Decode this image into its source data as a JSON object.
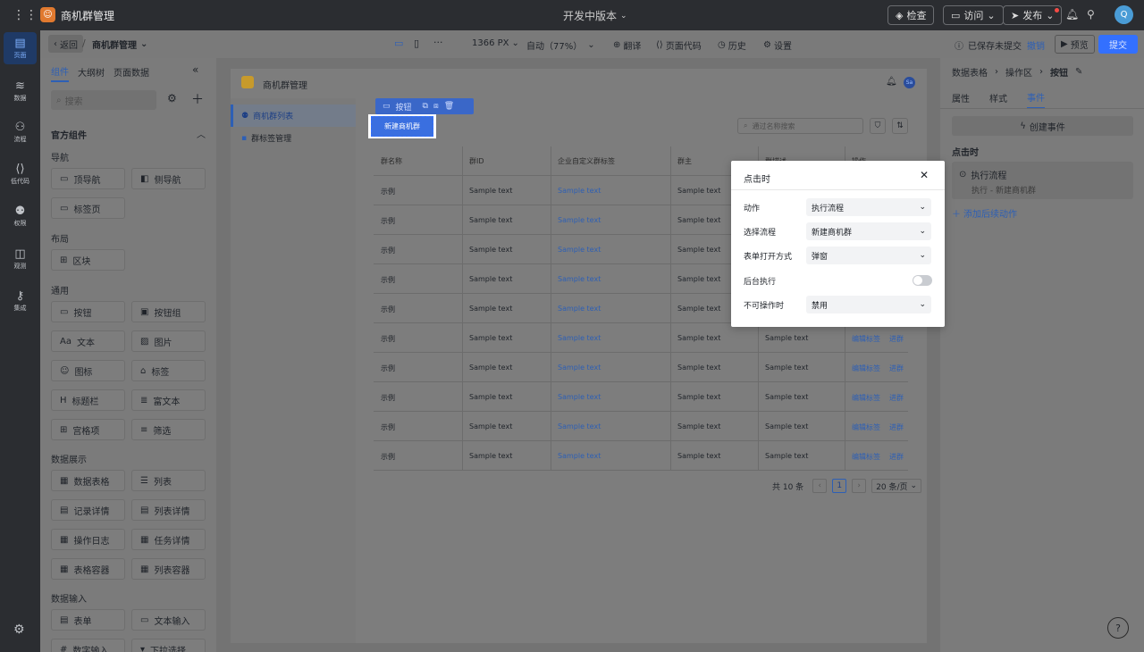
{
  "app": {
    "title": "商机群管理",
    "version_label": "开发中版本",
    "avatar_text": "Q"
  },
  "top_actions": {
    "inspect": "检查",
    "visit": "访问",
    "publish": "发布"
  },
  "rail": [
    "页面",
    "数据",
    "流程",
    "低代码",
    "权限",
    "观测",
    "集成"
  ],
  "toolbar": {
    "back": "返回",
    "separator": "/",
    "page_name": "商机群管理",
    "width": "1366 PX",
    "zoom": "自动（77%）",
    "translate": "翻译",
    "page_code": "页面代码",
    "history": "历史",
    "settings": "设置",
    "saved": "已保存未提交",
    "undo": "撤销",
    "preview": "预览",
    "submit": "提交"
  },
  "left_panel": {
    "tabs": [
      "组件",
      "大纲树",
      "页面数据"
    ],
    "search_placeholder": "搜索",
    "section_title": "官方组件",
    "groups": {
      "nav": {
        "title": "导航",
        "items": [
          "顶导航",
          "侧导航",
          "标签页"
        ]
      },
      "layout": {
        "title": "布局",
        "items": [
          "区块"
        ]
      },
      "general": {
        "title": "通用",
        "items": [
          "按钮",
          "按钮组",
          "文本",
          "图片",
          "图标",
          "标签",
          "标题栏",
          "富文本",
          "宫格项",
          "筛选"
        ]
      },
      "display": {
        "title": "数据展示",
        "items": [
          "数据表格",
          "列表",
          "记录详情",
          "列表详情",
          "操作日志",
          "任务详情",
          "表格容器",
          "列表容器"
        ]
      },
      "input": {
        "title": "数据输入",
        "items": [
          "表单",
          "文本输入",
          "数字输入",
          "下拉选择"
        ]
      }
    }
  },
  "canvas": {
    "header_title": "商机群管理",
    "header_avatar": "Sa",
    "side_nav": [
      "商机群列表",
      "群标签管理"
    ],
    "button_toolbar_label": "按钮",
    "create_button": "新建商机群",
    "search_placeholder": "通过名称搜索",
    "columns": [
      "群名称",
      "群ID",
      "企业自定义群标签",
      "群主",
      "群描述",
      "操作"
    ],
    "rows": [
      [
        "示例",
        "Sample text",
        "Sample text",
        "Sample text",
        "Sample text",
        "编辑标签",
        "进群"
      ],
      [
        "示例",
        "Sample text",
        "Sample text",
        "Sample text",
        "Sample text",
        "编辑标签",
        "进群"
      ],
      [
        "示例",
        "Sample text",
        "Sample text",
        "Sample text",
        "Sample text",
        "编辑标签",
        "进群"
      ],
      [
        "示例",
        "Sample text",
        "Sample text",
        "Sample text",
        "Sample text",
        "编辑标签",
        "进群"
      ],
      [
        "示例",
        "Sample text",
        "Sample text",
        "Sample text",
        "Sample text",
        "编辑标签",
        "进群"
      ],
      [
        "示例",
        "Sample text",
        "Sample text",
        "Sample text",
        "Sample text",
        "编辑标签",
        "进群"
      ],
      [
        "示例",
        "Sample text",
        "Sample text",
        "Sample text",
        "Sample text",
        "编辑标签",
        "进群"
      ],
      [
        "示例",
        "Sample text",
        "Sample text",
        "Sample text",
        "Sample text",
        "编辑标签",
        "进群"
      ],
      [
        "示例",
        "Sample text",
        "Sample text",
        "Sample text",
        "Sample text",
        "编辑标签",
        "进群"
      ],
      [
        "示例",
        "Sample text",
        "Sample text",
        "Sample text",
        "Sample text",
        "编辑标签",
        "进群"
      ]
    ],
    "pagination": {
      "total": "共 10 条",
      "page": "1",
      "page_size": "20 条/页",
      "prev": "‹",
      "next": "›"
    }
  },
  "right_panel": {
    "breadcrumb": [
      "数据表格",
      "操作区",
      "按钮"
    ],
    "tabs": [
      "属性",
      "样式",
      "事件"
    ],
    "create_event": "创建事件",
    "on_click": "点击时",
    "flow_title": "执行流程",
    "flow_sub": "执行 - 新建商机群",
    "add_action": "添加后续动作"
  },
  "popup": {
    "title": "点击时",
    "fields": [
      {
        "label": "动作",
        "value": "执行流程"
      },
      {
        "label": "选择流程",
        "value": "新建商机群"
      },
      {
        "label": "表单打开方式",
        "value": "弹窗"
      }
    ],
    "background_label": "后台执行",
    "background_on": false,
    "disabled_label": "不可操作时",
    "disabled_value": "禁用"
  },
  "help_icon": "?",
  "colors": {
    "accent": "#3370ff",
    "link": "#3a6ab8",
    "topbar": "#2b2d31"
  }
}
